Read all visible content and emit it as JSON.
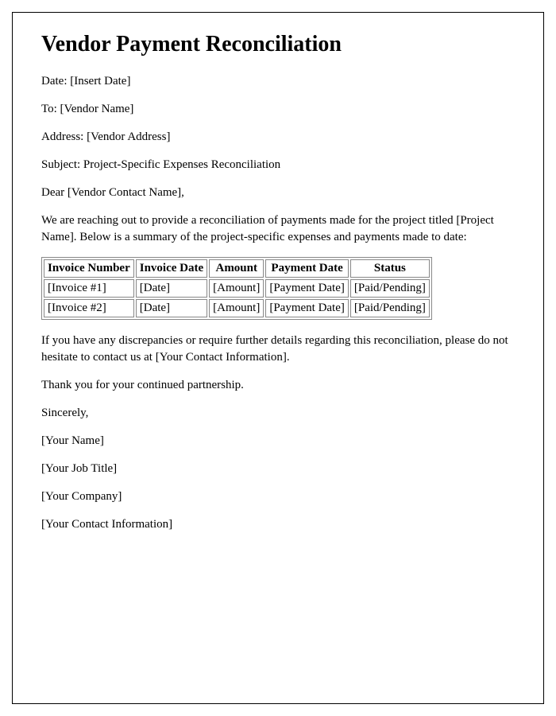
{
  "title": "Vendor Payment Reconciliation",
  "fields": {
    "date_label": "Date: ",
    "date_value": "[Insert Date]",
    "to_label": "To: ",
    "to_value": "[Vendor Name]",
    "address_label": "Address: ",
    "address_value": "[Vendor Address]",
    "subject_label": "Subject: ",
    "subject_value": "Project-Specific Expenses Reconciliation",
    "salutation": "Dear [Vendor Contact Name],",
    "intro": "We are reaching out to provide a reconciliation of payments made for the project titled [Project Name]. Below is a summary of the project-specific expenses and payments made to date:"
  },
  "table": {
    "headers": [
      "Invoice Number",
      "Invoice Date",
      "Amount",
      "Payment Date",
      "Status"
    ],
    "rows": [
      [
        "[Invoice #1]",
        "[Date]",
        "[Amount]",
        "[Payment Date]",
        "[Paid/Pending]"
      ],
      [
        "[Invoice #2]",
        "[Date]",
        "[Amount]",
        "[Payment Date]",
        "[Paid/Pending]"
      ]
    ]
  },
  "closing": {
    "note": "If you have any discrepancies or require further details regarding this reconciliation, please do not hesitate to contact us at [Your Contact Information].",
    "thanks": "Thank you for your continued partnership.",
    "signoff": "Sincerely,",
    "name": "[Your Name]",
    "job_title": "[Your Job Title]",
    "company": "[Your Company]",
    "contact": "[Your Contact Information]"
  }
}
